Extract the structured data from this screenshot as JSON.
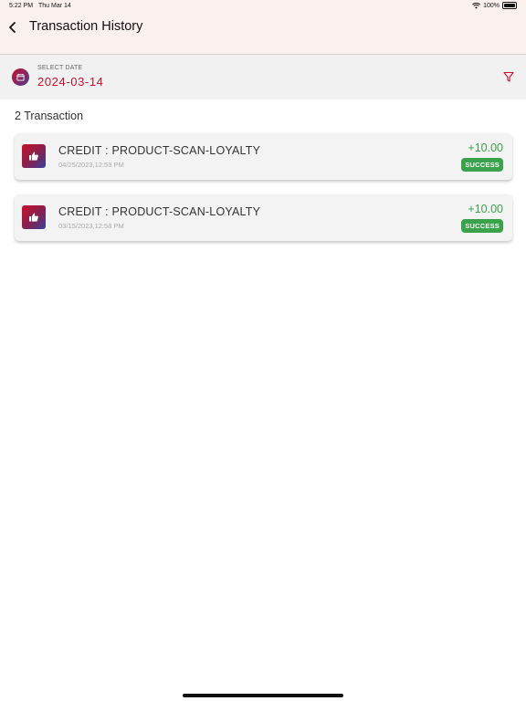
{
  "status_bar": {
    "time": "5:22 PM",
    "date": "Thu Mar 14",
    "battery": "100%"
  },
  "header": {
    "title": "Transaction History"
  },
  "date_filter": {
    "label": "SELECT DATE",
    "value": "2024-03-14"
  },
  "summary": {
    "count_text": "2 Transaction"
  },
  "transactions": [
    {
      "title": "CREDIT : PRODUCT-SCAN-LOYALTY",
      "timestamp": "04/25/2023,12:53 PM",
      "amount": "+10.00",
      "status": "SUCCESS"
    },
    {
      "title": "CREDIT : PRODUCT-SCAN-LOYALTY",
      "timestamp": "03/15/2023,12:58 PM",
      "amount": "+10.00",
      "status": "SUCCESS"
    }
  ],
  "colors": {
    "accent": "#c8102e",
    "success": "#3aa24b",
    "header_bg": "#faf1ef"
  },
  "icons": {
    "back": "chevron-left-icon",
    "calendar": "calendar-icon",
    "filter": "filter-icon",
    "transaction": "thumbs-up-icon"
  }
}
